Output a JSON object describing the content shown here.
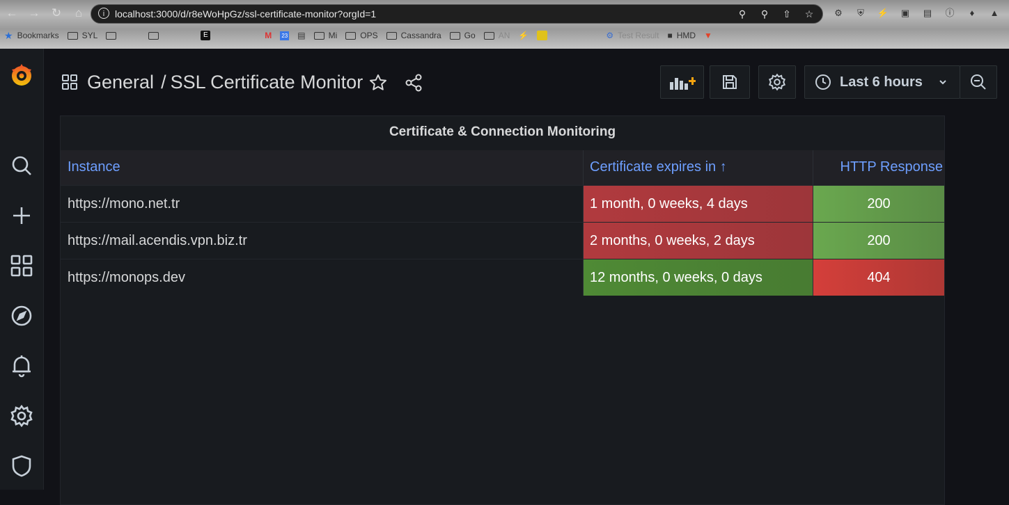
{
  "browser": {
    "url": "localhost:3000/d/r8eWoHpGz/ssl-certificate-monitor?orgId=1",
    "bookmarks": [
      {
        "icon": "star-icon",
        "label": "Bookmarks"
      },
      {
        "icon": "folder-icon",
        "label": "SYL"
      },
      {
        "icon": "folder-icon",
        "label": ""
      },
      {
        "icon": "folder-icon",
        "label": ""
      },
      {
        "icon": "app-icon",
        "label": ""
      },
      {
        "icon": "gmail-icon",
        "label": ""
      },
      {
        "icon": "calendar-icon",
        "label": ""
      },
      {
        "icon": "doc-icon",
        "label": ""
      },
      {
        "icon": "folder-icon",
        "label": "Mi"
      },
      {
        "icon": "folder-icon",
        "label": "OPS"
      },
      {
        "icon": "folder-icon",
        "label": "Cassandra"
      },
      {
        "icon": "folder-icon",
        "label": "Go"
      },
      {
        "icon": "folder-icon",
        "label": "AN"
      },
      {
        "icon": "bolt-icon",
        "label": ""
      },
      {
        "icon": "app-icon",
        "label": ""
      },
      {
        "icon": "gear-icon",
        "label": "Test Result"
      },
      {
        "icon": "doc-icon",
        "label": "HMD"
      },
      {
        "icon": "gitlab-icon",
        "label": ""
      }
    ]
  },
  "dashboard": {
    "folder": "General",
    "separator": "/",
    "title": "SSL Certificate Monitor",
    "time_range": "Last 6 hours"
  },
  "panel": {
    "title": "Certificate & Connection Monitoring",
    "columns": [
      "Instance",
      "Certificate expires in ↑",
      "HTTP Response"
    ],
    "rows": [
      {
        "instance": "https://mono.net.tr",
        "expires": "1 month, 0 weeks, 4 days",
        "http": "200",
        "expires_color": "#b13a3e",
        "http_color": "#6aa84f"
      },
      {
        "instance": "https://mail.acendis.vpn.biz.tr",
        "expires": "2 months, 0 weeks, 2 days",
        "http": "200",
        "expires_color": "#b13a3e",
        "http_color": "#6aa84f"
      },
      {
        "instance": "https://monops.dev",
        "expires": "12 months, 0 weeks, 0 days",
        "http": "404",
        "expires_color": "#4f8a35",
        "http_color": "#d43f3a"
      }
    ]
  }
}
